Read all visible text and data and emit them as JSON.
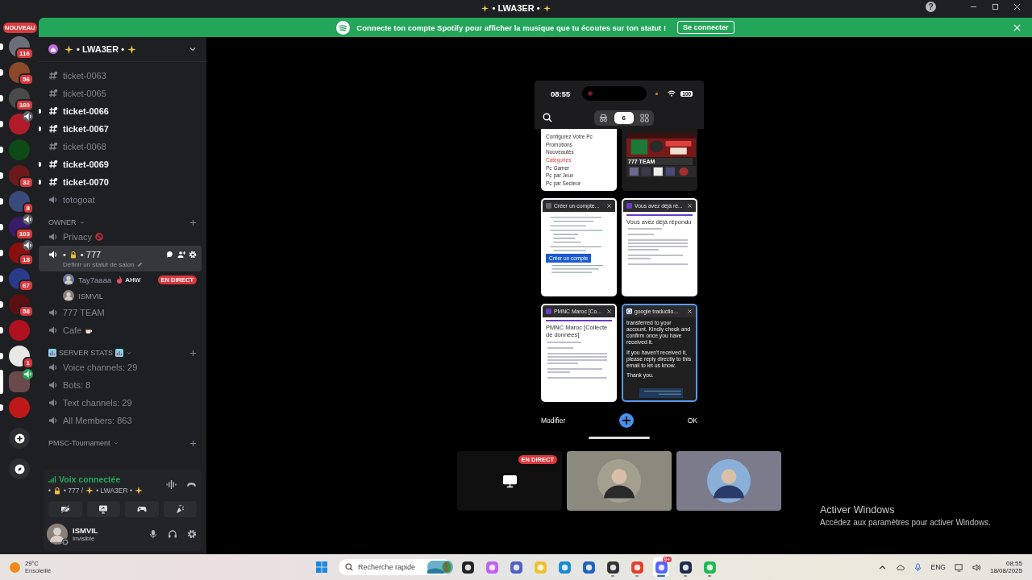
{
  "window": {
    "title": "• LWA3ER •",
    "help": "?"
  },
  "banner": {
    "text": "Connecte ton compte Spotify pour afficher la musique que tu écoutes sur ton statut !",
    "button": "Se connecter"
  },
  "server_rail": {
    "new_label": "NOUVEAU",
    "servers": [
      {
        "badge": "116",
        "unread": true,
        "audio": false,
        "selected": false
      },
      {
        "badge": "56",
        "unread": true,
        "audio": false,
        "selected": false
      },
      {
        "badge": "160",
        "unread": true,
        "audio": false,
        "selected": false
      },
      {
        "unread": true,
        "audio": true,
        "selected": false
      },
      {
        "unread": true,
        "audio": false,
        "selected": false
      },
      {
        "badge": "32",
        "unread": true,
        "audio": false,
        "selected": false
      },
      {
        "badge": "8",
        "unread": true,
        "audio": false,
        "selected": false
      },
      {
        "badge": "103",
        "unread": true,
        "audio": true,
        "selected": false
      },
      {
        "badge": "18",
        "unread": true,
        "audio": true,
        "selected": false
      },
      {
        "badge": "67",
        "unread": true,
        "audio": false,
        "selected": false
      },
      {
        "badge": "58",
        "unread": true,
        "audio": false,
        "selected": false
      },
      {
        "unread": true,
        "audio": false,
        "selected": false
      },
      {
        "badge": "1",
        "unread": true,
        "audio": false,
        "selected": false
      },
      {
        "unread": false,
        "audio": true,
        "selected": true
      },
      {
        "unread": true,
        "audio": false,
        "selected": false
      }
    ]
  },
  "server": {
    "name": "• LWA3ER •"
  },
  "sections": [
    {
      "channels": [
        {
          "kind": "text",
          "name": "ticket-0063",
          "unread": false,
          "selected": false
        },
        {
          "kind": "text",
          "name": "ticket-0065",
          "unread": false,
          "selected": false
        },
        {
          "kind": "text",
          "name": "ticket-0066",
          "unread": true,
          "selected": false
        },
        {
          "kind": "text",
          "name": "ticket-0067",
          "unread": true,
          "selected": false
        },
        {
          "kind": "text",
          "name": "ticket-0068",
          "unread": false,
          "selected": false
        },
        {
          "kind": "text",
          "name": "ticket-0069",
          "unread": true,
          "selected": false
        },
        {
          "kind": "text",
          "name": "ticket-0070",
          "unread": true,
          "selected": false
        },
        {
          "kind": "voice",
          "name": "totogoat",
          "unread": false,
          "selected": false
        }
      ]
    },
    {
      "category": "OWNER",
      "channels": [
        {
          "kind": "voice",
          "name": "Privacy",
          "unread": false,
          "selected": false
        },
        {
          "kind": "voice",
          "prefix": "•",
          "name": "• 777",
          "unread": false,
          "selected": true,
          "status": "Définir un statut de salon",
          "members": [
            {
              "name": "Tay7aaaa",
              "tag": "AHW",
              "live": "EN DIRECT"
            },
            {
              "name": "ISMVIL"
            }
          ]
        },
        {
          "kind": "voice",
          "name": "777 TEAM",
          "unread": false,
          "selected": false
        },
        {
          "kind": "voice",
          "name": "Cafe",
          "unread": false,
          "selected": false
        }
      ]
    },
    {
      "category": "SERVER STATS",
      "channels": [
        {
          "kind": "voice",
          "name": "Voice channels: 29",
          "unread": false,
          "selected": false
        },
        {
          "kind": "voice",
          "name": "Bots: 8",
          "unread": false,
          "selected": false
        },
        {
          "kind": "voice",
          "name": "Text channels: 29",
          "unread": false,
          "selected": false
        },
        {
          "kind": "voice",
          "name": "All Members: 863",
          "unread": false,
          "selected": false
        }
      ]
    },
    {
      "category": "PMSC-Tournament"
    }
  ],
  "voice_panel": {
    "status": "Voix connectée",
    "prefix": "•",
    "channel": "• 777 /",
    "server": "• LWA3ER •"
  },
  "user": {
    "name": "ISMVIL",
    "status": "Invisible"
  },
  "phone": {
    "time": "08:55",
    "battery": "100",
    "tab_count": "6",
    "edit": "Modifier",
    "ok": "OK",
    "cards": [
      {
        "kind": "menu",
        "selected": false,
        "items": [
          {
            "text": "Configurez Votre Pc",
            "active": false
          },
          {
            "text": "Promotions",
            "active": false
          },
          {
            "text": "Nouveautés",
            "active": false
          },
          {
            "text": "Catégories",
            "active": true
          },
          {
            "text": "Pc Gamer",
            "active": false
          },
          {
            "text": "Pc par Jeux",
            "active": false
          },
          {
            "text": "Pc par Secteur",
            "active": false
          }
        ]
      },
      {
        "kind": "media",
        "selected": false,
        "heading": "777 TEAM"
      },
      {
        "kind": "doc",
        "title": "Créer un compte...",
        "selected": false,
        "button": "Créer un compte"
      },
      {
        "kind": "form",
        "title": "Vous avez déjà ré...",
        "selected": false,
        "heading": "Vous avez déjà répondu"
      },
      {
        "kind": "form",
        "title": "PMNC Maroc [Co...",
        "selected": false,
        "heading": "PMNC Maroc [Collecte de données]"
      },
      {
        "kind": "dark",
        "title": "google traductio...",
        "selected": true,
        "paragraphs": [
          "transferred to your account. Kindly check and confirm once you have received it.",
          "If you haven't received it, please reply directly to this email to let us know.",
          "Thank you."
        ]
      }
    ]
  },
  "tiles": [
    {
      "kind": "screen",
      "live": "EN DIRECT"
    },
    {
      "kind": "camera"
    },
    {
      "kind": "camera"
    }
  ],
  "activation": {
    "title": "Activer Windows",
    "text": "Accédez aux paramètres pour activer Windows."
  },
  "taskbar": {
    "weather": {
      "temp": "29°C",
      "condition": "Ensoleillé"
    },
    "search": {
      "placeholder": "Recherche rapide"
    },
    "apps": [
      {
        "running": false,
        "active": false
      },
      {
        "running": false,
        "active": false
      },
      {
        "running": false,
        "active": false
      },
      {
        "running": false,
        "active": false
      },
      {
        "running": false,
        "active": false
      },
      {
        "running": false,
        "active": false
      },
      {
        "running": true,
        "active": false
      },
      {
        "running": true,
        "active": false
      },
      {
        "running": true,
        "active": true,
        "badge": "9+"
      },
      {
        "running": true,
        "active": false
      },
      {
        "running": true,
        "active": false
      }
    ],
    "language": "ENG",
    "time": "08:55",
    "date": "18/08/2025"
  }
}
